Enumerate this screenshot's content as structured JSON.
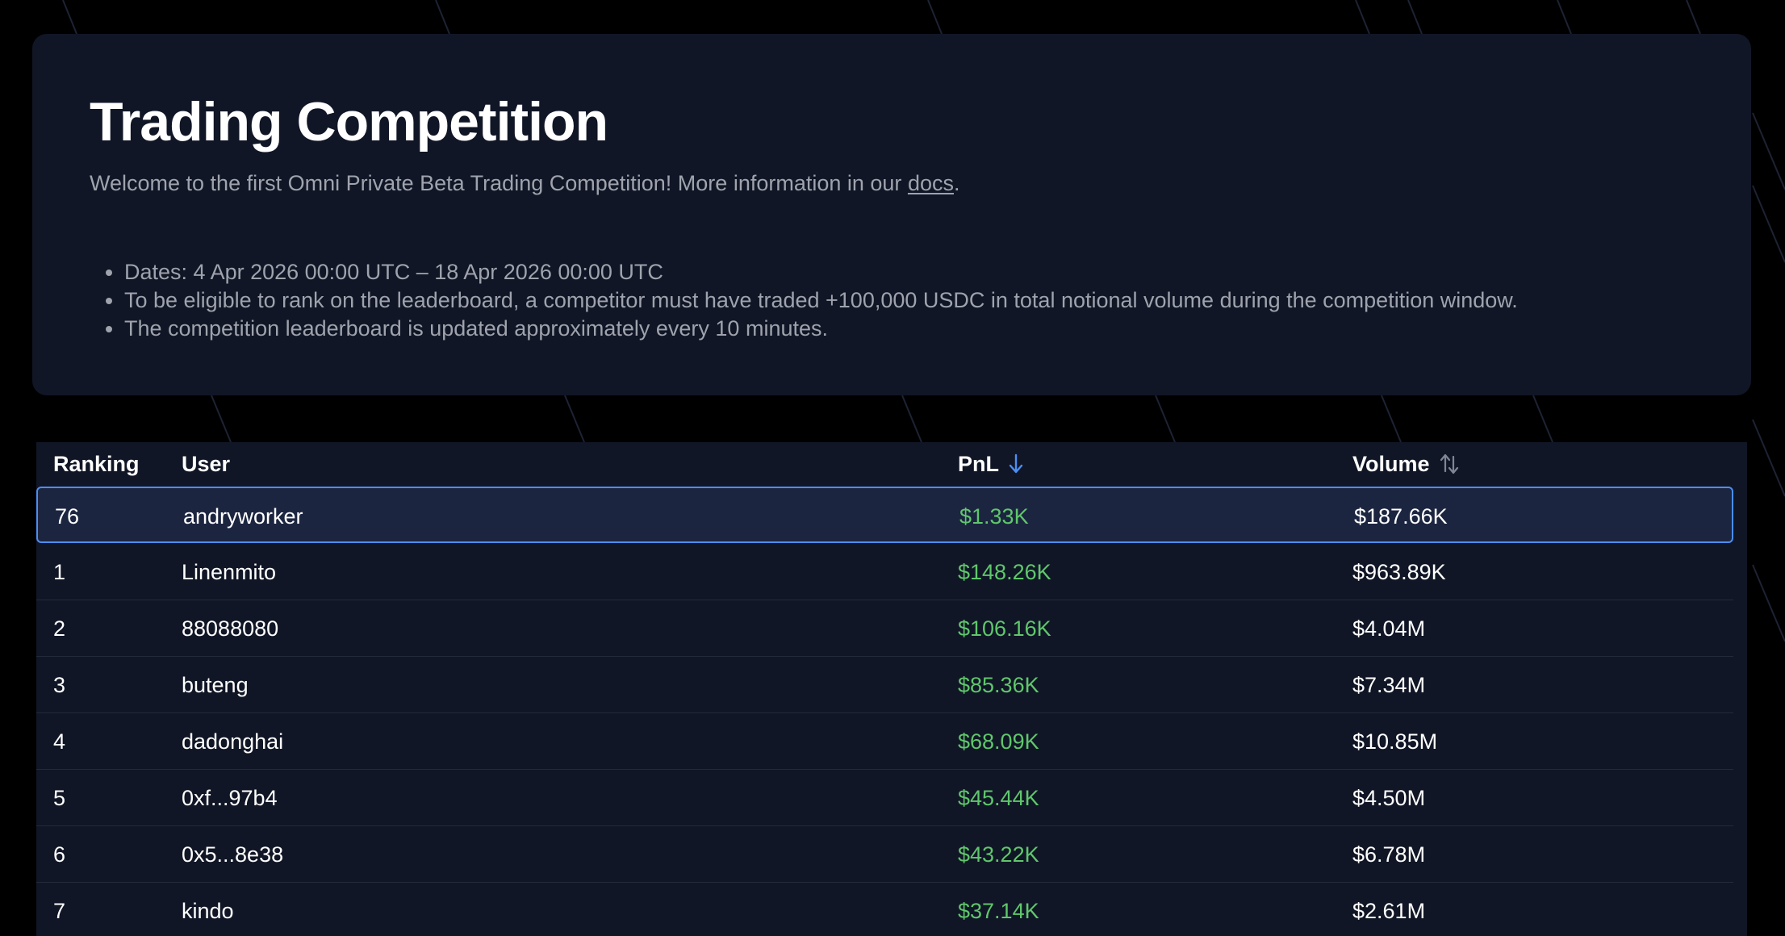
{
  "hero": {
    "title": "Trading Competition",
    "intro_text": "Welcome to the first Omni Private Beta Trading Competition! More information in our ",
    "docs_link": "docs",
    "intro_end": ".",
    "rules": [
      "Dates: 4 Apr 2026 00:00 UTC – 18 Apr 2026 00:00 UTC",
      "To be eligible to rank on the leaderboard, a competitor must have traded +100,000 USDC in total notional volume during the competition window.",
      "The competition leaderboard is updated approximately every 10 minutes."
    ]
  },
  "leaderboard": {
    "columns": {
      "ranking": "Ranking",
      "user": "User",
      "pnl": "PnL",
      "volume": "Volume"
    },
    "sort": {
      "pnl_icon": "arrow-down-icon",
      "volume_icon": "sort-arrows-icon",
      "active_color": "#4c8ef2"
    },
    "rows": [
      {
        "rank": "76",
        "user": "andryworker",
        "pnl": "$1.33K",
        "volume": "$187.66K",
        "current_user": true
      },
      {
        "rank": "1",
        "user": "Linenmito",
        "pnl": "$148.26K",
        "volume": "$963.89K"
      },
      {
        "rank": "2",
        "user": "88088080",
        "pnl": "$106.16K",
        "volume": "$4.04M"
      },
      {
        "rank": "3",
        "user": "buteng",
        "pnl": "$85.36K",
        "volume": "$7.34M"
      },
      {
        "rank": "4",
        "user": "dadonghai",
        "pnl": "$68.09K",
        "volume": "$10.85M"
      },
      {
        "rank": "5",
        "user": "0xf...97b4",
        "pnl": "$45.44K",
        "volume": "$4.50M"
      },
      {
        "rank": "6",
        "user": "0x5...8e38",
        "pnl": "$43.22K",
        "volume": "$6.78M"
      },
      {
        "rank": "7",
        "user": "kindo",
        "pnl": "$37.14K",
        "volume": "$2.61M"
      }
    ]
  },
  "colors": {
    "page_bg": "#000000",
    "panel_bg": "#111626",
    "highlight_row_bg": "#1c2540",
    "highlight_border": "#4c8ef2",
    "positive_pnl": "#5fc76b",
    "muted_text": "#9ea3ad"
  }
}
